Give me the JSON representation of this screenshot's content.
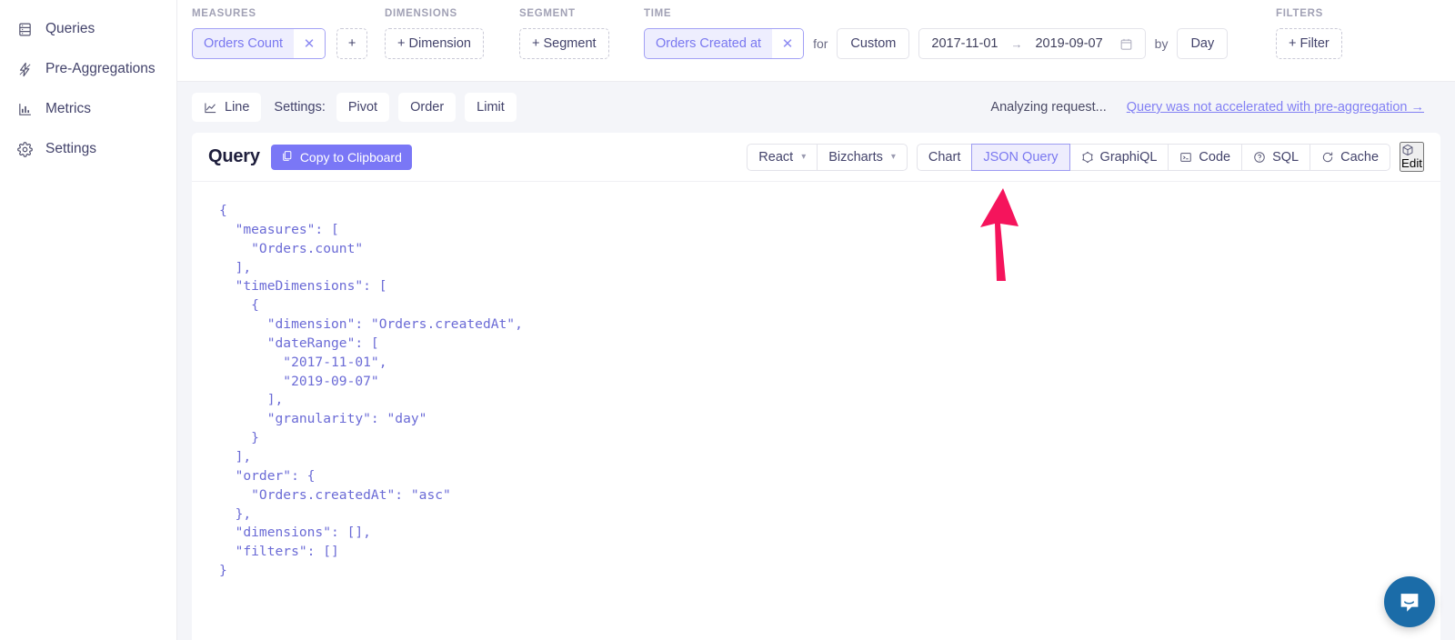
{
  "sidebar": {
    "items": [
      {
        "label": "Queries",
        "icon": "database-icon"
      },
      {
        "label": "Pre-Aggregations",
        "icon": "lightning-icon"
      },
      {
        "label": "Metrics",
        "icon": "bar-chart-icon"
      },
      {
        "label": "Settings",
        "icon": "gear-icon"
      }
    ]
  },
  "builder": {
    "measures": {
      "group_label": "MEASURES",
      "tag": "Orders Count",
      "remove": "✕",
      "add": "+"
    },
    "dimensions": {
      "group_label": "DIMENSIONS",
      "add": "+  Dimension"
    },
    "segment": {
      "group_label": "SEGMENT",
      "add": "+  Segment"
    },
    "time": {
      "group_label": "TIME",
      "tag": "Orders Created at",
      "remove": "✕",
      "for_label": "for",
      "range_preset": "Custom",
      "date_start": "2017-11-01",
      "date_arrow": "→",
      "date_end": "2019-09-07",
      "by_label": "by",
      "granularity": "Day"
    },
    "filters": {
      "group_label": "FILTERS",
      "add": "+  Filter"
    }
  },
  "settingsbar": {
    "chart_type": "Line",
    "settings_label": "Settings:",
    "pivot": "Pivot",
    "order": "Order",
    "limit": "Limit",
    "status": "Analyzing request...",
    "warning_link": "Query was not accelerated with pre-aggregation →"
  },
  "card": {
    "title": "Query",
    "copy_button": "Copy to Clipboard",
    "framework": "React",
    "charting_lib": "Bizcharts",
    "tabs": [
      {
        "label": "Chart",
        "active": false
      },
      {
        "label": "JSON Query",
        "active": true
      }
    ],
    "actions": [
      {
        "label": "GraphiQL",
        "icon": "graphiql-icon"
      },
      {
        "label": "Code",
        "icon": "terminal-icon"
      },
      {
        "label": "SQL",
        "icon": "question-circle-icon"
      },
      {
        "label": "Cache",
        "icon": "refresh-icon"
      }
    ],
    "edit": {
      "label": "Edit",
      "icon": "cube-icon"
    },
    "json_query": "{\n  \"measures\": [\n    \"Orders.count\"\n  ],\n  \"timeDimensions\": [\n    {\n      \"dimension\": \"Orders.createdAt\",\n      \"dateRange\": [\n        \"2017-11-01\",\n        \"2019-09-07\"\n      ],\n      \"granularity\": \"day\"\n    }\n  ],\n  \"order\": {\n    \"Orders.createdAt\": \"asc\"\n  },\n  \"dimensions\": [],\n  \"filters\": []\n}"
  },
  "annotation": {
    "name": "pink-arrow",
    "color": "#f5145c"
  },
  "chat": {
    "name": "intercom-launcher",
    "color": "#1b6ca8"
  },
  "colors": {
    "accent_purple": "#7a77f6",
    "tag_bg": "#eeeefe",
    "tag_border": "#a2a0f5",
    "page_bg": "#f4f5f9"
  }
}
